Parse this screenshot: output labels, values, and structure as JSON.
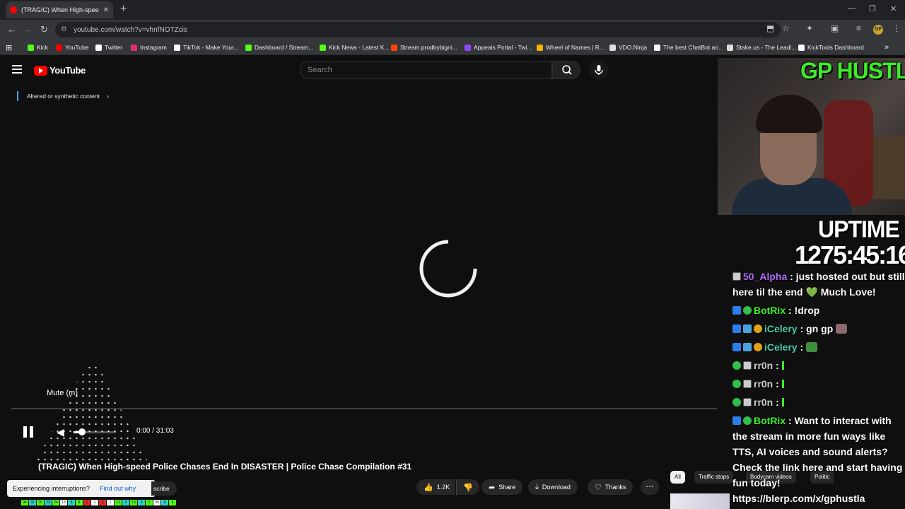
{
  "browser": {
    "tab_title": "(TRAGIC) When High-speed Po...",
    "close": "✕",
    "new_tab": "+",
    "window_controls": [
      "—",
      "❐",
      "✕"
    ],
    "url": "youtube.com/watch?v=vhnfNOTZcis",
    "bookmarks": [
      {
        "label": "Kick",
        "color": "#53fc18"
      },
      {
        "label": "YouTube",
        "color": "#ff0000"
      },
      {
        "label": "Twitter",
        "color": "#ffffff"
      },
      {
        "label": "Instagram",
        "color": "#e1306c"
      },
      {
        "label": "TikTok - Make Your...",
        "color": "#ffffff"
      },
      {
        "label": "Dashboard / Stream...",
        "color": "#53fc18"
      },
      {
        "label": "Kick News - Latest K...",
        "color": "#53fc18"
      },
      {
        "label": "Stream prodbybigni...",
        "color": "#ff4500"
      },
      {
        "label": "Appeals Portal - Twi...",
        "color": "#9146ff"
      },
      {
        "label": "Wheel of Names | R...",
        "color": "#f4b400"
      },
      {
        "label": "VDO.Ninja",
        "color": "#dddddd"
      },
      {
        "label": "The best ChatBot an...",
        "color": "#ffffff"
      },
      {
        "label": "Stake.us - The Leadi...",
        "color": "#dddddd"
      },
      {
        "label": "KickTools Dashboard",
        "color": "#ffffff"
      }
    ]
  },
  "youtube": {
    "logo_text": "YouTube",
    "search_placeholder": "Search",
    "altered_label": "Altered or synthetic content",
    "player": {
      "mute_tooltip": "Mute (m)",
      "time": "0:00 / 31:03",
      "volume": 0.2
    },
    "video_title": "(TRAGIC) When High-speed Police Chases End In DISASTER | Police Chase Compilation #31",
    "interrupt_text": "Experiencing interruptions?",
    "interrupt_link": "Find out why",
    "subscribe_label": "scribe",
    "actions": {
      "like_count": "1.2K",
      "share": "Share",
      "download": "Download",
      "thanks": "Thanks"
    },
    "chips": [
      "All",
      "Traffic stops",
      "Bodycam videos",
      "Politic"
    ]
  },
  "overlay": {
    "brand": "GP HUSTLA",
    "uptime_label": "UPTIME",
    "uptime_value": "1275:45:16",
    "chat": [
      {
        "user": "50_Alpha",
        "text": ": just hosted out but still here til the end 💚 Much Love!"
      },
      {
        "user": "BotRix",
        "text": ": !drop"
      },
      {
        "user": "iCelery",
        "text": ": gn gp"
      },
      {
        "user": "iCelery",
        "text": ":"
      },
      {
        "user": "rr0n",
        "text": ":"
      },
      {
        "user": "rr0n",
        "text": ":"
      },
      {
        "user": "rr0n",
        "text": ":"
      },
      {
        "user": "BotRix",
        "text": ": Want to interact with the stream in more fun ways like TTS, AI voices and sound alerts? Check the link here and start having fun today! https://blerp.com/x/gphustla"
      }
    ]
  },
  "strip_labels": [
    "94",
    "32",
    "35",
    "23",
    "24",
    "13",
    "5",
    "8",
    "1",
    "1",
    "2",
    "1",
    "13",
    "5",
    "13",
    "5",
    "5",
    "35",
    "9",
    "6"
  ]
}
